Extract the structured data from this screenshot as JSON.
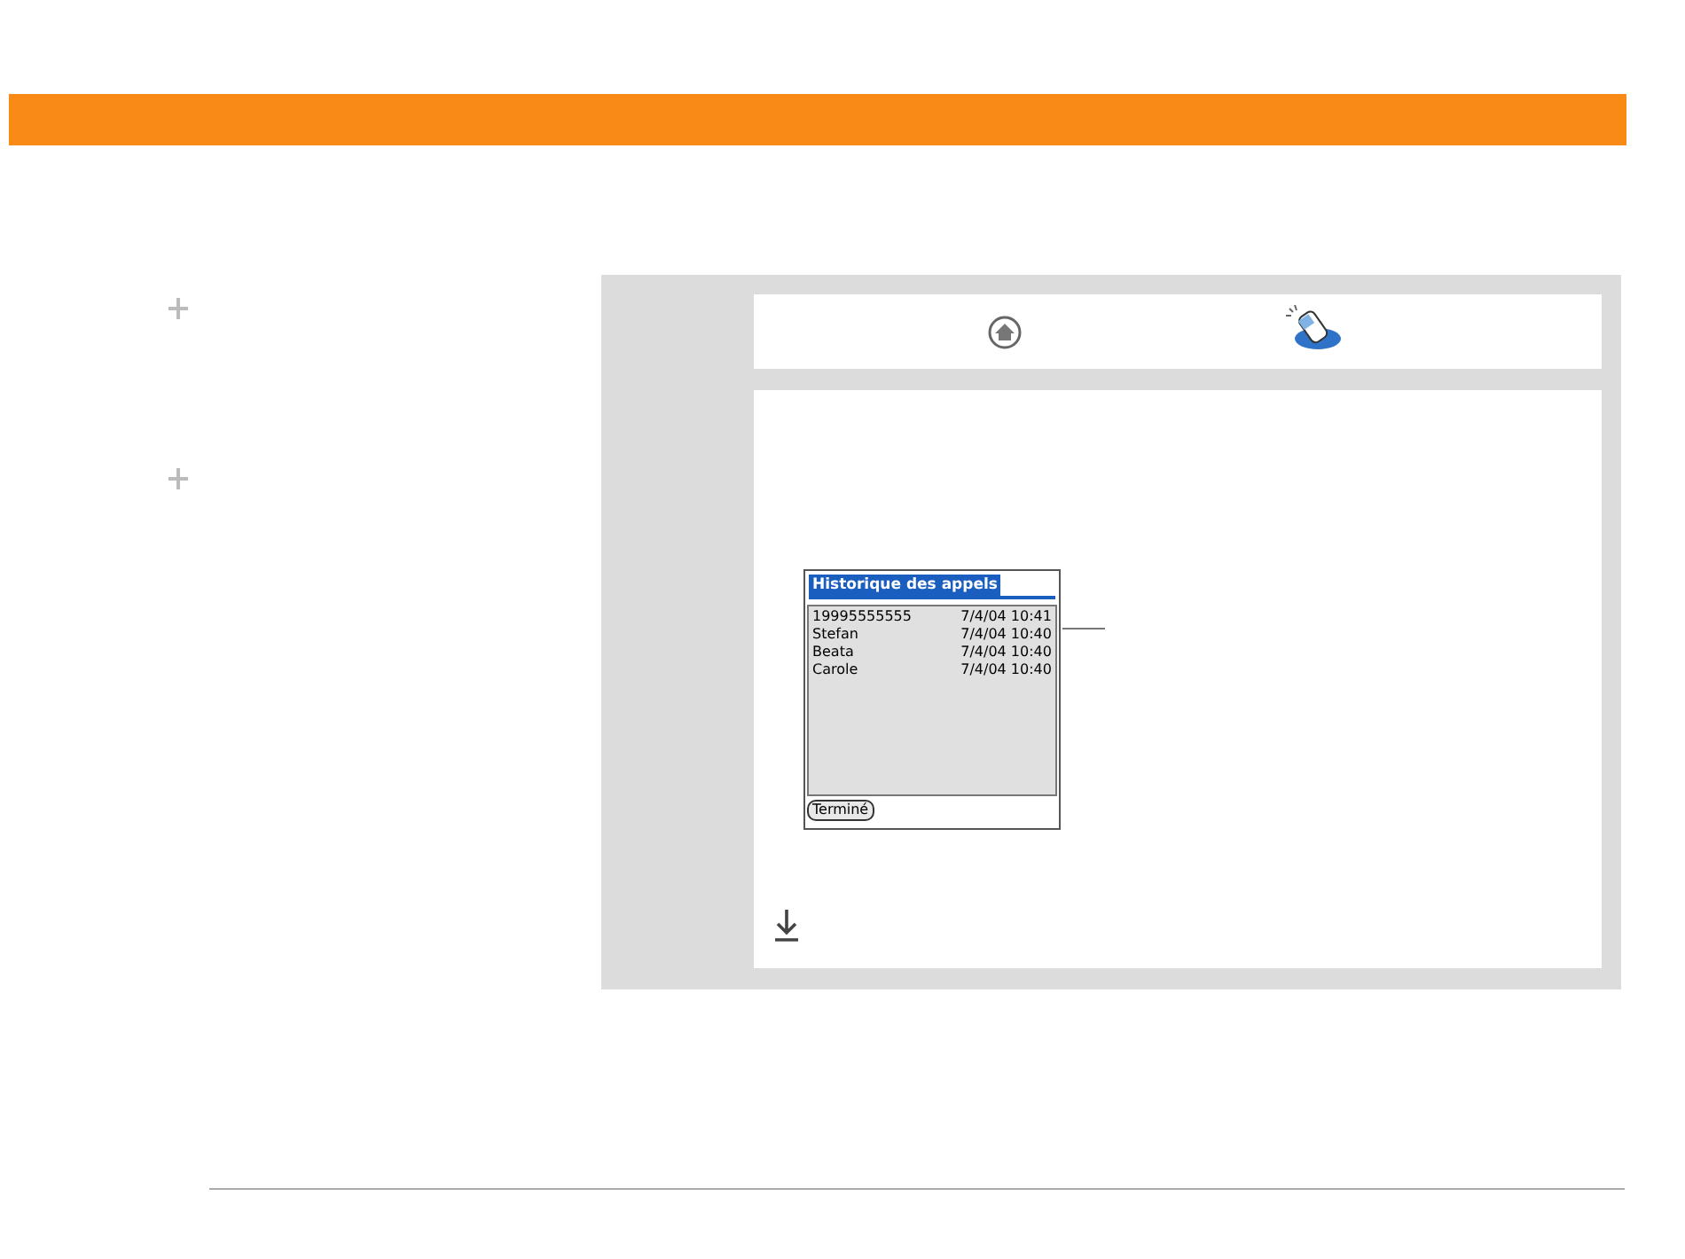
{
  "palm_screen": {
    "title": "Historique des appels",
    "calls": [
      {
        "name": "19995555555",
        "time": "7/4/04 10:41"
      },
      {
        "name": "Stefan",
        "time": "7/4/04 10:40"
      },
      {
        "name": "Beata",
        "time": "7/4/04 10:40"
      },
      {
        "name": "Carole",
        "time": "7/4/04 10:40"
      }
    ],
    "button": "Terminé"
  }
}
